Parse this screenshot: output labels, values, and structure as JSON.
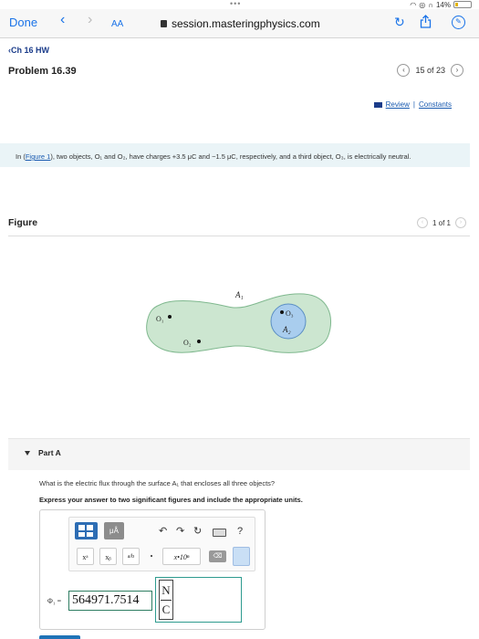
{
  "status_bar": {
    "battery_text": "14%"
  },
  "browser": {
    "done_label": "Done",
    "text_size_label": "AA",
    "url": "session.masteringphysics.com"
  },
  "course": {
    "breadcrumb": "Ch 16 HW",
    "problem_title": "Problem 16.39",
    "page_indicator": "15 of 23",
    "review_label": "Review",
    "separator": "|",
    "constants_label": "Constants"
  },
  "statement": {
    "prefix": "In (",
    "figure_link": "Figure 1",
    "text": "), two objects, O₁ and O₂, have charges +3.5 μC and −1.5 μC, respectively, and a third object, O₃, is electrically neutral."
  },
  "figure": {
    "title": "Figure",
    "page_indicator": "1 of 1",
    "surface_label_1": "A₁",
    "surface_label_2": "A₂",
    "object_1": "O₁",
    "object_2": "O₂",
    "object_3": "O₃"
  },
  "part_a": {
    "title": "Part A",
    "question": "What is the electric flux through the surface A₁ that encloses all three objects?",
    "instruction": "Express your answer to two significant figures and include the appropriate units."
  },
  "editor": {
    "units_button": "μÅ",
    "power_button": "xᵃ",
    "subscript_button": "xᵦ",
    "fraction_button": "a/b",
    "dot_button": "•",
    "scientific_button": "x•10ⁿ",
    "help_button": "?",
    "undo_icon": "undo-icon",
    "redo_icon": "redo-icon",
    "reset_icon": "reset-icon",
    "keyboard_icon": "keyboard-icon"
  },
  "answer": {
    "symbol": "Φ₁ =",
    "value": "564971.7514",
    "unit_numerator": "N",
    "unit_denominator": "C"
  }
}
